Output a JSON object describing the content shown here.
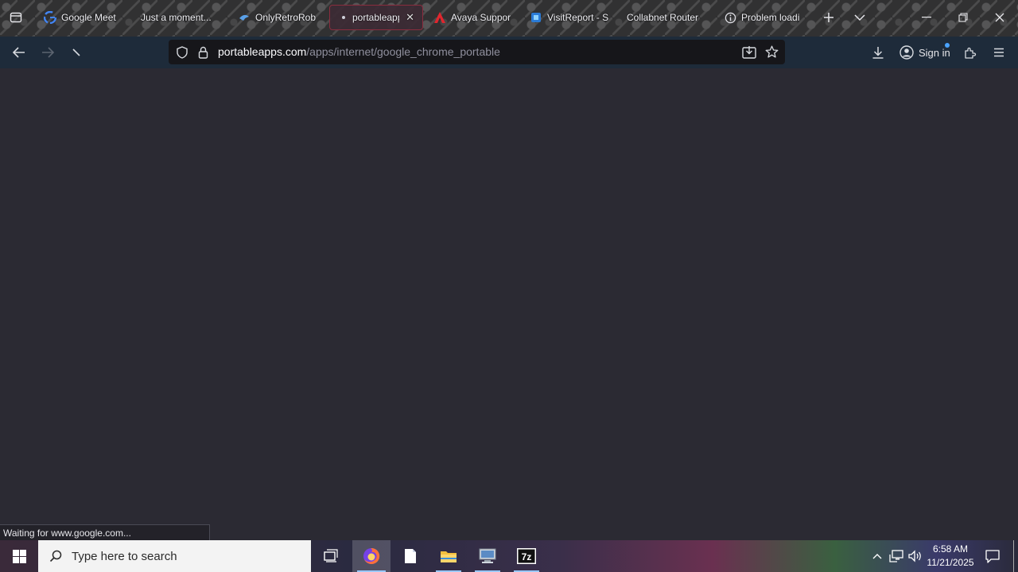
{
  "tabs": [
    {
      "title": "Google Meet",
      "icon": "google-g-icon"
    },
    {
      "title": "Just a moment...",
      "icon": ""
    },
    {
      "title": "OnlyRetroRob",
      "icon": "retro-bird-icon"
    },
    {
      "title": "portableapp",
      "icon": "loading-dot-icon",
      "active": true
    },
    {
      "title": "Avaya Suppor",
      "icon": "avaya-icon"
    },
    {
      "title": "VisitReport - S",
      "icon": "visitreport-icon"
    },
    {
      "title": "Collabnet Router",
      "icon": ""
    },
    {
      "title": "Problem loadi",
      "icon": "info-icon"
    }
  ],
  "tab_close_symbol": "✕",
  "url": {
    "domain": "portableapps.com",
    "path": "/apps/internet/google_chrome_portable"
  },
  "toolbar": {
    "signin_label": "Sign in"
  },
  "status_text": "Waiting for www.google.com...",
  "taskbar": {
    "search_placeholder": "Type here to search",
    "time": "6:58 AM",
    "date": "11/21/2025"
  },
  "colors": {
    "accent_tab_border": "#8a2d3e",
    "navbar": "#1e2b3a",
    "content_bg": "#2b2a33",
    "urlbar_bg": "#16161a"
  }
}
